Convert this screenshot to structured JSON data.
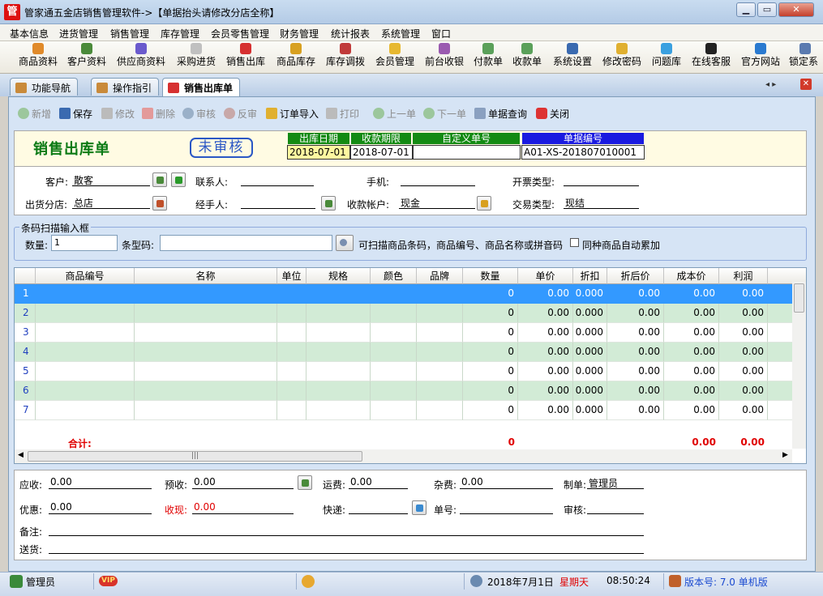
{
  "window": {
    "app_icon": "管",
    "title": "管家通五金店销售管理软件->【单据抬头请修改分店全称】",
    "minimize": "▁",
    "maximize": "▭",
    "close": "✕"
  },
  "menu": [
    "基本信息",
    "进货管理",
    "销售管理",
    "库存管理",
    "会员零售管理",
    "财务管理",
    "统计报表",
    "系统管理",
    "窗口"
  ],
  "toolbar": [
    "商品资料",
    "客户资料",
    "供应商资料",
    "采购进货",
    "销售出库",
    "商品库存",
    "库存调拨",
    "会员管理",
    "前台收银",
    "付款单",
    "收款单",
    "系统设置",
    "修改密码",
    "问题库",
    "在线客服",
    "官方网站",
    "锁定系"
  ],
  "tabs": [
    "功能导航",
    "操作指引",
    "销售出库单"
  ],
  "tab_nav": "◂ ▸",
  "actions": [
    "新增",
    "保存",
    "修改",
    "删除",
    "审核",
    "反审",
    "订单导入",
    "打印",
    "上一单",
    "下一单",
    "单据查询",
    "关闭"
  ],
  "doc": {
    "title": "销售出库单",
    "status": "未审核",
    "out_date_label": "出库日期",
    "out_date": "2018-07-01",
    "due_label": "收款期限",
    "due": "2018-07-01",
    "custom_label": "自定义单号",
    "custom": "",
    "no_label": "单据编号",
    "no": "A01-XS-201807010001"
  },
  "form": {
    "customer_label": "客户:",
    "customer": "散客",
    "contact_label": "联系人:",
    "contact": "",
    "phone_label": "手机:",
    "phone": "",
    "invoice_label": "开票类型:",
    "invoice": "",
    "branch_label": "出货分店:",
    "branch": "总店",
    "handler_label": "经手人:",
    "handler": "",
    "account_label": "收款帐户:",
    "account": "现金",
    "trade_label": "交易类型:",
    "trade": "现结"
  },
  "scan": {
    "legend": "条码扫描输入框",
    "qty_label": "数量:",
    "qty": "1",
    "code_label": "条型码:",
    "code": "",
    "hint": "可扫描商品条码，商品编号、商品名称或拼音码",
    "accumulate": "同种商品自动累加"
  },
  "grid": {
    "columns": [
      "商品编号",
      "名称",
      "单位",
      "规格",
      "颜色",
      "品牌",
      "数量",
      "单价",
      "折扣",
      "折后价",
      "成本价",
      "利润"
    ],
    "rows": [
      {
        "n": "1",
        "qty": "0",
        "price": "0.00",
        "disc": "0.000",
        "dprice": "0.00",
        "cost": "0.00",
        "profit": "0.00"
      },
      {
        "n": "2",
        "qty": "0",
        "price": "0.00",
        "disc": "0.000",
        "dprice": "0.00",
        "cost": "0.00",
        "profit": "0.00"
      },
      {
        "n": "3",
        "qty": "0",
        "price": "0.00",
        "disc": "0.000",
        "dprice": "0.00",
        "cost": "0.00",
        "profit": "0.00"
      },
      {
        "n": "4",
        "qty": "0",
        "price": "0.00",
        "disc": "0.000",
        "dprice": "0.00",
        "cost": "0.00",
        "profit": "0.00"
      },
      {
        "n": "5",
        "qty": "0",
        "price": "0.00",
        "disc": "0.000",
        "dprice": "0.00",
        "cost": "0.00",
        "profit": "0.00"
      },
      {
        "n": "6",
        "qty": "0",
        "price": "0.00",
        "disc": "0.000",
        "dprice": "0.00",
        "cost": "0.00",
        "profit": "0.00"
      },
      {
        "n": "7",
        "qty": "0",
        "price": "0.00",
        "disc": "0.000",
        "dprice": "0.00",
        "cost": "0.00",
        "profit": "0.00"
      }
    ],
    "total_label": "合计:",
    "total_qty": "0",
    "total_cost": "0.00",
    "total_profit": "0.00",
    "scroll_thumb": "|||"
  },
  "footer": {
    "receivable_label": "应收:",
    "receivable": "0.00",
    "prepaid_label": "预收:",
    "prepaid": "0.00",
    "freight_label": "运费:",
    "freight": "0.00",
    "misc_label": "杂费:",
    "misc": "0.00",
    "maker_label": "制单:",
    "maker": "管理员",
    "discount_label": "优惠:",
    "discount": "0.00",
    "cash_label": "收现:",
    "cash": "0.00",
    "express_label": "快递:",
    "express": "",
    "track_label": "单号:",
    "track": "",
    "audit_label": "审核:",
    "audit": "",
    "remark_label": "备注:",
    "remark": "",
    "deliver_label": "送货:",
    "deliver": ""
  },
  "status": {
    "user": "管理员",
    "vip": "VIP",
    "date": "2018年7月1日",
    "weekday": "星期天",
    "time": "08:50:24",
    "version": "版本号: 7.0 单机版"
  },
  "colors": {
    "accent": "#3399ff",
    "green_header": "#138a13",
    "blue_header": "#1a1ae0",
    "alt_row": "#d2ebd6",
    "red": "#e00000"
  }
}
